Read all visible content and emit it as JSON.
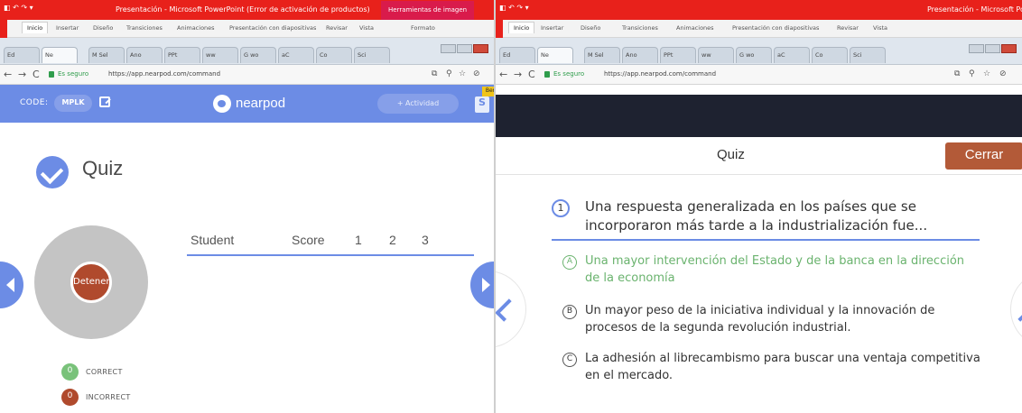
{
  "left": {
    "window": {
      "title": "Presentación - Microsoft PowerPoint (Error de activación de productos)",
      "context_tab": "Herramientas de imagen",
      "ribbon_tabs": [
        "Inicio",
        "Insertar",
        "Diseño",
        "Transiciones",
        "Animaciones",
        "Presentación con diapositivas",
        "Revisar",
        "Vista",
        "Formato"
      ],
      "browser_tabs": [
        "Ed",
        "Ne",
        "M Sel",
        "Ano",
        "PPt",
        "ww",
        "G wo",
        "aC",
        "Co",
        "Sci"
      ],
      "active_tab": "Ne",
      "secure_label": "Es seguro",
      "url": "https://app.nearpod.com/command"
    },
    "header": {
      "code_label": "CODE:",
      "code_value": "MPLK",
      "logo_text": "nearpod",
      "activity_button": "+ Actividad",
      "side_badge": "S",
      "corner_tag": "Ber"
    },
    "quiz": {
      "title": "Quiz",
      "stop_button": "Detener"
    },
    "table": {
      "columns": [
        "Student",
        "Score",
        "1",
        "2",
        "3"
      ]
    },
    "legend": [
      {
        "count": "0",
        "label": "CORRECT",
        "color": "#79c27a"
      },
      {
        "count": "0",
        "label": "INCORRECT",
        "color": "#b04a2d"
      }
    ]
  },
  "right": {
    "window": {
      "title": "Presentación - Microsoft PowerPoint",
      "ribbon_tabs": [
        "Inicio",
        "Insertar",
        "Diseño",
        "Transiciones",
        "Animaciones",
        "Presentación con diapositivas",
        "Revisar",
        "Vista"
      ],
      "browser_tabs": [
        "Ed",
        "Ne",
        "M Sel",
        "Ano",
        "PPt",
        "ww",
        "G wo",
        "aC",
        "Co",
        "Sci"
      ],
      "active_tab": "Ne",
      "secure_label": "Es seguro",
      "url": "https://app.nearpod.com/command"
    },
    "quiz": {
      "title": "Quiz",
      "close_button": "Cerrar",
      "question_number": "1",
      "question": "Una respuesta generalizada en los países que se incorporaron más tarde a la industrialización fue...",
      "options": [
        {
          "letter": "A",
          "text": "Una mayor intervención del Estado y de la banca en la dirección de la economía",
          "correct": true
        },
        {
          "letter": "B",
          "text": "Un mayor peso de la iniciativa individual y la innovación de procesos de la segunda revolución industrial.",
          "correct": false
        },
        {
          "letter": "C",
          "text": "La adhesión al librecambismo para buscar una ventaja competitiva en el mercado.",
          "correct": false
        }
      ]
    }
  },
  "colors": {
    "nearpod_blue": "#6c8ce5",
    "stop_red": "#b04a2d",
    "close_brown": "#b35a38",
    "correct_green": "#6ab36e",
    "office_red": "#e8211b"
  }
}
